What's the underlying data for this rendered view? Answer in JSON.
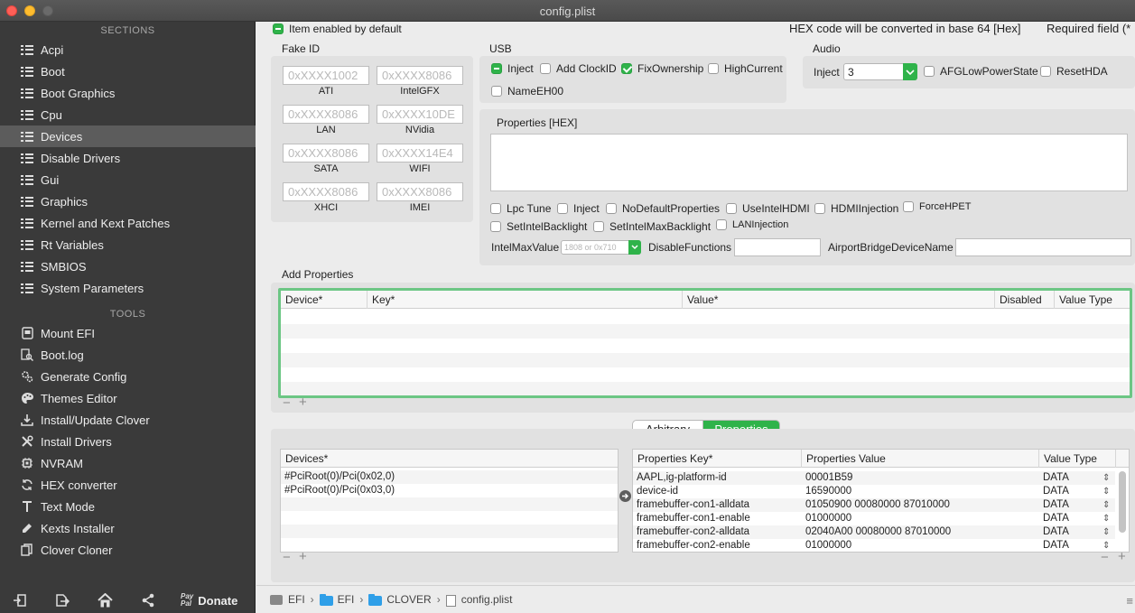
{
  "window": {
    "title": "config.plist"
  },
  "sidebar": {
    "sections_heading": "SECTIONS",
    "sections": [
      {
        "label": "Acpi",
        "icon": "list-icon"
      },
      {
        "label": "Boot",
        "icon": "list-icon"
      },
      {
        "label": "Boot Graphics",
        "icon": "list-icon"
      },
      {
        "label": "Cpu",
        "icon": "list-icon"
      },
      {
        "label": "Devices",
        "icon": "list-icon",
        "selected": true
      },
      {
        "label": "Disable Drivers",
        "icon": "list-icon"
      },
      {
        "label": "Gui",
        "icon": "list-icon"
      },
      {
        "label": "Graphics",
        "icon": "list-icon"
      },
      {
        "label": "Kernel and Kext Patches",
        "icon": "list-icon"
      },
      {
        "label": "Rt Variables",
        "icon": "list-icon"
      },
      {
        "label": "SMBIOS",
        "icon": "list-icon"
      },
      {
        "label": "System Parameters",
        "icon": "list-icon"
      }
    ],
    "tools_heading": "TOOLS",
    "tools": [
      {
        "label": "Mount EFI",
        "icon": "disk-icon"
      },
      {
        "label": "Boot.log",
        "icon": "log-search-icon"
      },
      {
        "label": "Generate Config",
        "icon": "gears-icon"
      },
      {
        "label": "Themes Editor",
        "icon": "palette-icon"
      },
      {
        "label": "Install/Update Clover",
        "icon": "download-icon"
      },
      {
        "label": "Install Drivers",
        "icon": "wrench-icon"
      },
      {
        "label": "NVRAM",
        "icon": "chip-icon"
      },
      {
        "label": "HEX converter",
        "icon": "refresh-icon"
      },
      {
        "label": "Text Mode",
        "icon": "text-icon"
      },
      {
        "label": "Kexts Installer",
        "icon": "dropper-icon"
      },
      {
        "label": "Clover Cloner",
        "icon": "copy-icon"
      }
    ],
    "bottom": {
      "donate_label": "Donate",
      "paypal_top": "Pay",
      "paypal_bottom": "Pal"
    }
  },
  "header": {
    "item_enabled": "Item enabled by default",
    "hex_note": "HEX code will be converted in base 64 [Hex]",
    "required_note": "Required field (*"
  },
  "fake_id": {
    "label": "Fake ID",
    "fields": [
      {
        "placeholder": "0xXXXX1002",
        "label": "ATI"
      },
      {
        "placeholder": "0xXXXX8086",
        "label": "IntelGFX"
      },
      {
        "placeholder": "0xXXXX8086",
        "label": "LAN"
      },
      {
        "placeholder": "0xXXXX10DE",
        "label": "NVidia"
      },
      {
        "placeholder": "0xXXXX8086",
        "label": "SATA"
      },
      {
        "placeholder": "0xXXXX14E4",
        "label": "WIFI"
      },
      {
        "placeholder": "0xXXXX8086",
        "label": "XHCI"
      },
      {
        "placeholder": "0xXXXX8086",
        "label": "IMEI"
      }
    ]
  },
  "usb": {
    "label": "USB",
    "inject": "Inject",
    "add_clockid": "Add ClockID",
    "fix_ownership": "FixOwnership",
    "high_current": "HighCurrent",
    "name_eh00": "NameEH00"
  },
  "audio": {
    "label": "Audio",
    "inject_label": "Inject",
    "inject_value": "3",
    "afg_low_power": "AFGLowPowerState",
    "reset_hda": "ResetHDA"
  },
  "properties_hex": {
    "label": "Properties [HEX]",
    "lpc_tune": "Lpc Tune",
    "inject": "Inject",
    "no_default_properties": "NoDefaultProperties",
    "use_intel_hdmi": "UseIntelHDMI",
    "hdmi_injection": "HDMIInjection",
    "force_hpet": "ForceHPET",
    "set_intel_backlight": "SetIntelBacklight",
    "set_intel_max_backlight": "SetIntelMaxBacklight",
    "lan_injection": "LANInjection",
    "intel_max_value_label": "IntelMaxValue",
    "intel_max_value_placeholder": "1808 or 0x710",
    "disable_functions_label": "DisableFunctions",
    "airport_bridge_label": "AirportBridgeDeviceName"
  },
  "add_properties": {
    "label": "Add Properties",
    "columns": [
      "Device*",
      "Key*",
      "Value*",
      "Disabled",
      "Value Type"
    ]
  },
  "segment": {
    "arbitrary": "Arbitrary",
    "properties": "Properties"
  },
  "devices_table": {
    "header": "Devices*",
    "rows": [
      "#PciRoot(0)/Pci(0x02,0)",
      "#PciRoot(0)/Pci(0x03,0)"
    ]
  },
  "props_table": {
    "columns": [
      "Properties Key*",
      "Properties Value",
      "Value Type"
    ],
    "rows": [
      {
        "key": "AAPL,ig-platform-id",
        "value": "00001B59",
        "type": "DATA"
      },
      {
        "key": "device-id",
        "value": "16590000",
        "type": "DATA"
      },
      {
        "key": "framebuffer-con1-alldata",
        "value": "01050900 00080000 87010000",
        "type": "DATA"
      },
      {
        "key": "framebuffer-con1-enable",
        "value": "01000000",
        "type": "DATA"
      },
      {
        "key": "framebuffer-con2-alldata",
        "value": "02040A00 00080000 87010000",
        "type": "DATA"
      },
      {
        "key": "framebuffer-con2-enable",
        "value": "01000000",
        "type": "DATA"
      }
    ]
  },
  "pathbar": {
    "items": [
      "EFI",
      "EFI",
      "CLOVER",
      "config.plist"
    ]
  },
  "colors": {
    "accent_green": "#2fb34a",
    "sidebar_bg": "#3a3a3a",
    "selected_row": "#5c5c5c"
  }
}
